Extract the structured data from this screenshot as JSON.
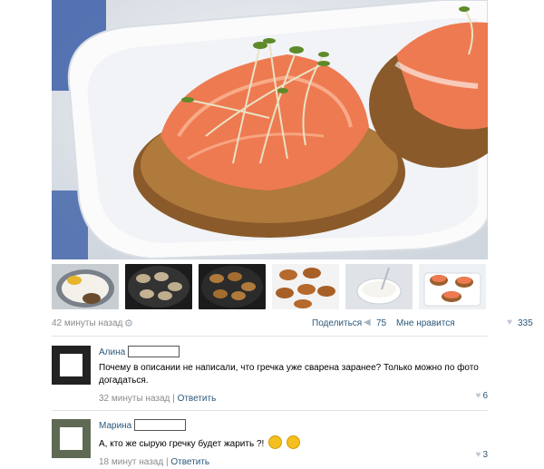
{
  "post": {
    "time_ago": "42 минуты назад",
    "share_label": "Поделиться",
    "share_count": "75",
    "like_label": "Мне нравится",
    "like_count": "335"
  },
  "thumbnails": [
    {
      "name": "eggs-flour-bowl"
    },
    {
      "name": "patties-in-pan-raw"
    },
    {
      "name": "patties-frying"
    },
    {
      "name": "fritters-on-paper"
    },
    {
      "name": "sauce-bowl"
    },
    {
      "name": "fritters-served-plate"
    }
  ],
  "comments": [
    {
      "author": "Алина",
      "text": "Почему в описании не написали, что гречка уже сварена заранее? Только можно по фото догадаться.",
      "time_ago": "32 минуты назад",
      "reply_label": "Ответить",
      "likes": "6"
    },
    {
      "author": "Марина",
      "text": "А, кто же сырую гречку будет жарить ?!",
      "time_ago": "18 минут назад",
      "reply_label": "Ответить",
      "likes": "3"
    }
  ],
  "colors": {
    "link": "#2b587a",
    "meta": "#8a8a8a",
    "divider": "#dfe4ea"
  }
}
